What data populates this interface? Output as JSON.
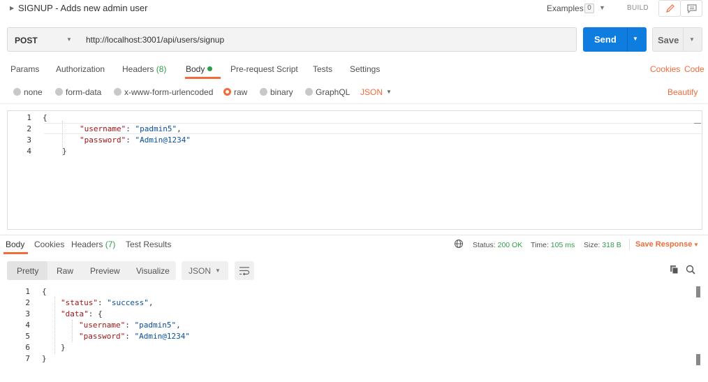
{
  "header": {
    "request_title": "SIGNUP - Adds new admin user",
    "examples_label": "Examples",
    "examples_count": "0",
    "build_label": "BUILD"
  },
  "request": {
    "method": "POST",
    "url": "http://localhost:3001/api/users/signup",
    "send_label": "Send",
    "save_label": "Save"
  },
  "request_tabs": [
    {
      "label": "Params"
    },
    {
      "label": "Authorization"
    },
    {
      "label": "Headers",
      "count": "(8)"
    },
    {
      "label": "Body"
    },
    {
      "label": "Pre-request Script"
    },
    {
      "label": "Tests"
    },
    {
      "label": "Settings"
    }
  ],
  "links": {
    "cookies": "Cookies",
    "code": "Code",
    "beautify": "Beautify"
  },
  "body_types": [
    {
      "label": "none",
      "selected": false
    },
    {
      "label": "form-data",
      "selected": false
    },
    {
      "label": "x-www-form-urlencoded",
      "selected": false
    },
    {
      "label": "raw",
      "selected": true
    },
    {
      "label": "binary",
      "selected": false
    },
    {
      "label": "GraphQL",
      "selected": false
    }
  ],
  "raw_format": "JSON",
  "request_body": {
    "line_numbers": [
      "1",
      "2",
      "3",
      "4"
    ],
    "open_brace": "{",
    "close_brace": "}",
    "username_key": "\"username\"",
    "username_val": "\"padmin5\"",
    "password_key": "\"password\"",
    "password_val": "\"Admin@1234\""
  },
  "response_tabs": [
    {
      "label": "Body"
    },
    {
      "label": "Cookies"
    },
    {
      "label": "Headers",
      "count": "(7)"
    },
    {
      "label": "Test Results"
    }
  ],
  "response_meta": {
    "status_label": "Status:",
    "status_value": "200 OK",
    "time_label": "Time:",
    "time_value": "105 ms",
    "size_label": "Size:",
    "size_value": "318 B",
    "save_response": "Save Response"
  },
  "response_views": [
    "Pretty",
    "Raw",
    "Preview",
    "Visualize"
  ],
  "response_format": "JSON",
  "response_body": {
    "line_numbers": [
      "1",
      "2",
      "3",
      "4",
      "5",
      "6",
      "7"
    ],
    "open_brace": "{",
    "close_brace": "}",
    "status_key": "\"status\"",
    "status_val": "\"success\"",
    "data_key": "\"data\"",
    "data_open": "{",
    "data_close": "}",
    "username_key": "\"username\"",
    "username_val": "\"padmin5\"",
    "password_key": "\"password\"",
    "password_val": "\"Admin@1234\""
  },
  "colors": {
    "accent": "#f26b3a",
    "send_blue": "#0f7de0",
    "success_green": "#2e9e4a"
  }
}
